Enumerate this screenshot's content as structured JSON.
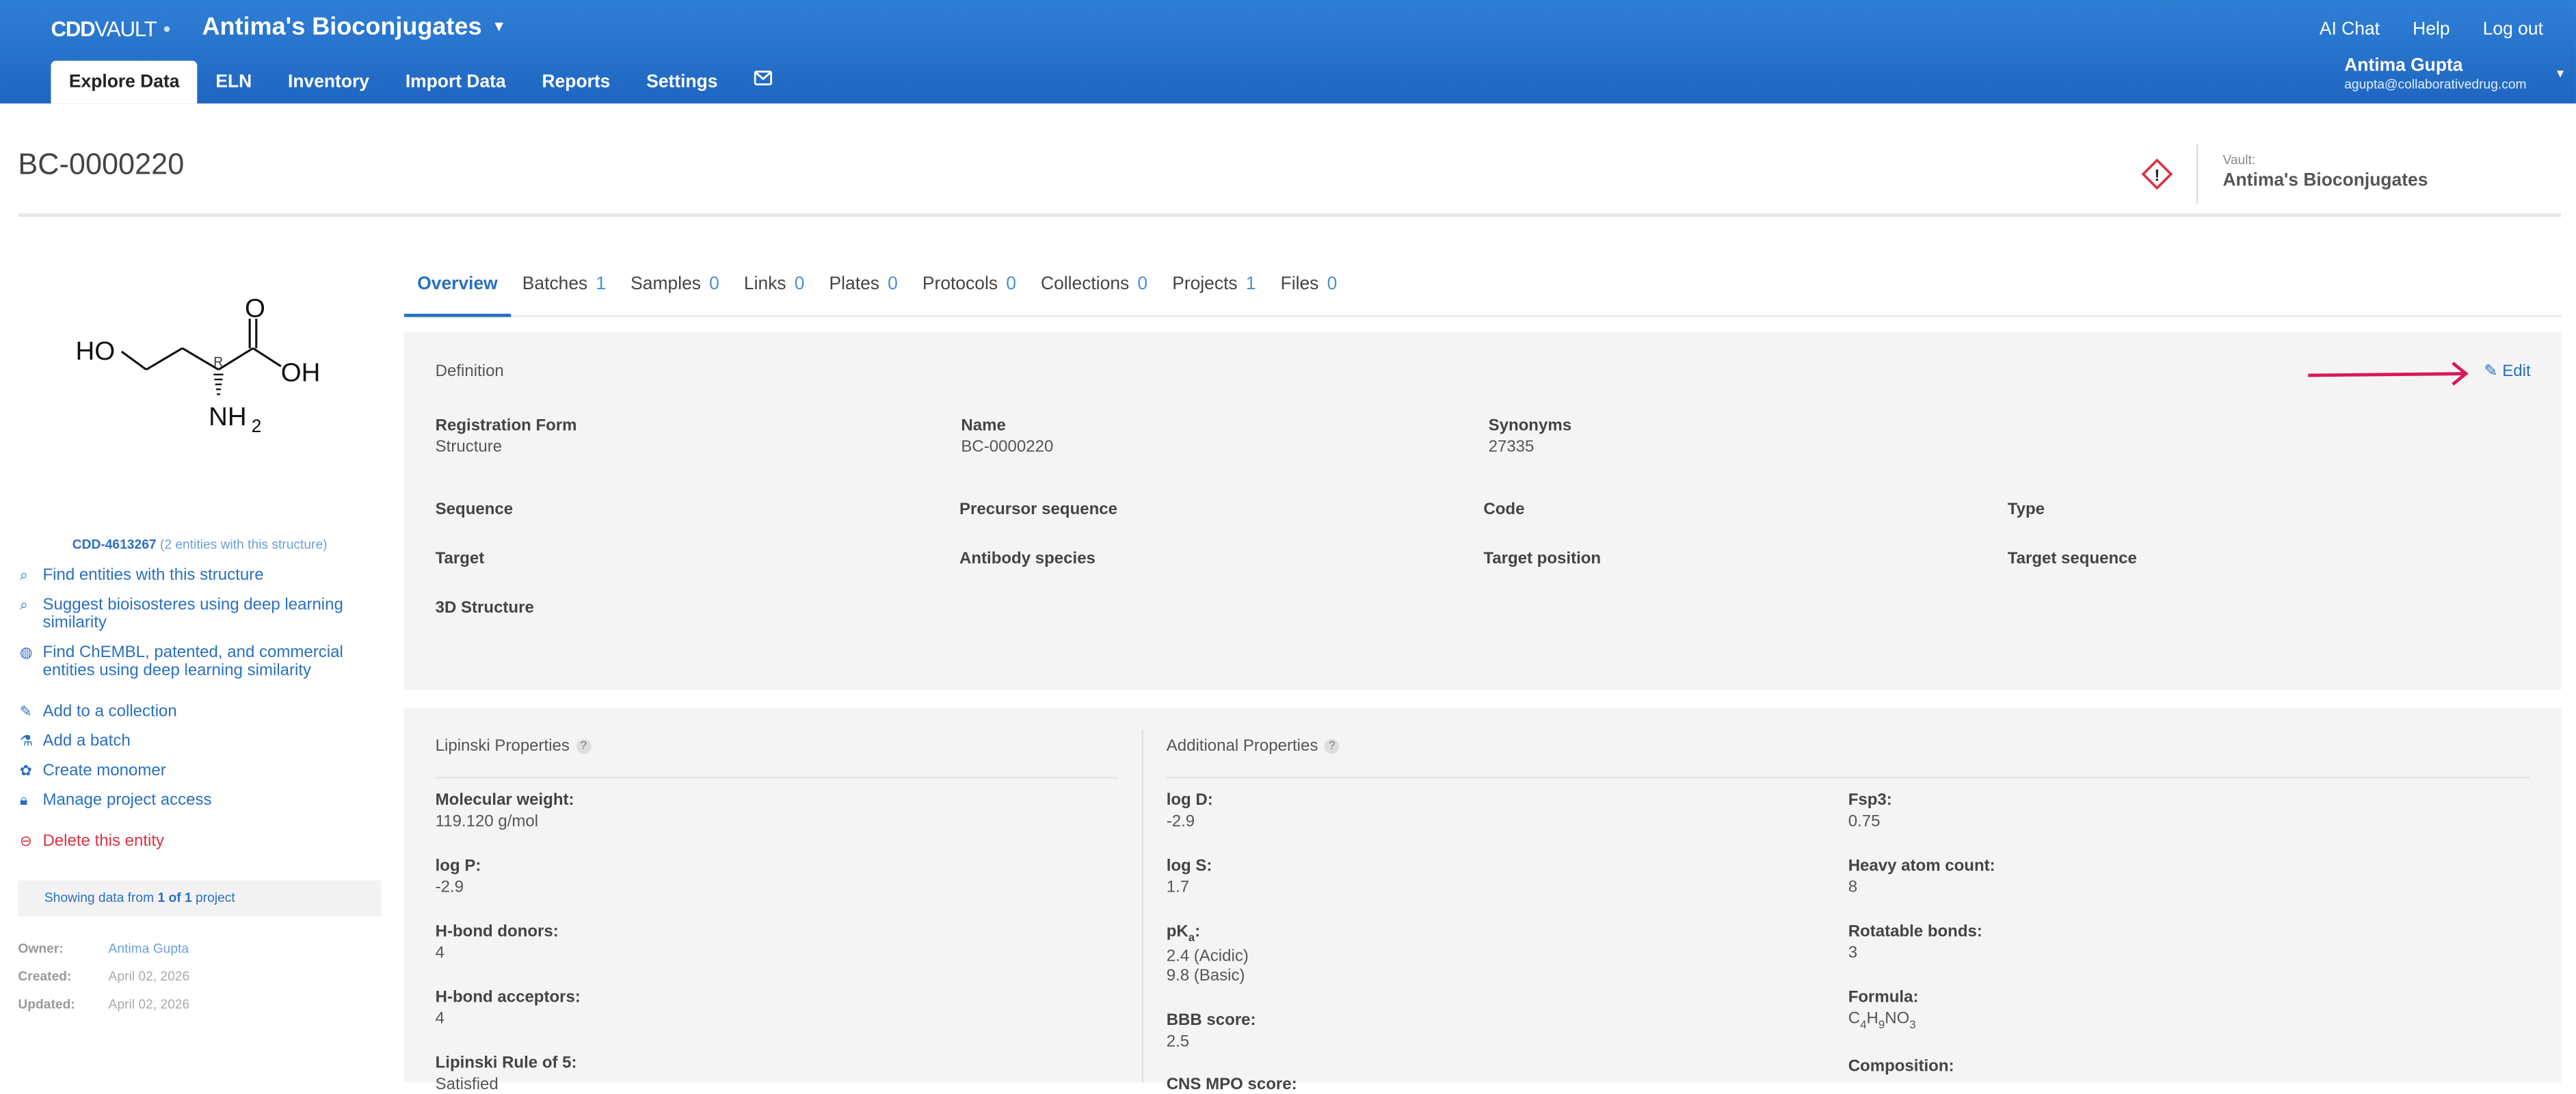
{
  "header": {
    "logo_bold": "CDD",
    "logo_light": "VAULT",
    "vault_name": "Antima's Bioconjugates",
    "right_links": [
      "AI Chat",
      "Help",
      "Log out"
    ],
    "nav": [
      "Explore Data",
      "ELN",
      "Inventory",
      "Import Data",
      "Reports",
      "Settings"
    ],
    "user_name": "Antima Gupta",
    "user_email": "agupta@collaborativedrug.com"
  },
  "entity": {
    "title": "BC-0000220",
    "vault_label": "Vault:",
    "vault_value": "Antima's Bioconjugates"
  },
  "structure": {
    "atoms": [
      "HO",
      "O",
      "OH",
      "NH",
      "2",
      "R"
    ],
    "cdd_id": "CDD-4613267",
    "cdd_note": "(2 entities with this structure)"
  },
  "left_actions": [
    {
      "icon": "search-icon",
      "label": "Find entities with this structure"
    },
    {
      "icon": "search-icon",
      "label": "Suggest bioisosteres using deep learning similarity"
    },
    {
      "icon": "globe-icon",
      "label": "Find ChEMBL, patented, and commercial entities using deep learning similarity"
    },
    {
      "icon": "collection-icon",
      "label": "Add to a collection"
    },
    {
      "icon": "flask-icon",
      "label": "Add a batch"
    },
    {
      "icon": "monomer-icon",
      "label": "Create monomer"
    },
    {
      "icon": "lock-icon",
      "label": "Manage project access"
    },
    {
      "icon": "delete-icon",
      "label": "Delete this entity"
    }
  ],
  "project_box": {
    "prefix": "Showing data from ",
    "count": "1 of 1",
    "suffix": " project"
  },
  "meta": [
    {
      "key": "Owner:",
      "value": "Antima Gupta"
    },
    {
      "key": "Created:",
      "value": "April 02, 2026"
    },
    {
      "key": "Updated:",
      "value": "April 02, 2026"
    }
  ],
  "tabs": [
    {
      "label": "Overview",
      "count": ""
    },
    {
      "label": "Batches",
      "count": "1"
    },
    {
      "label": "Samples",
      "count": "0"
    },
    {
      "label": "Links",
      "count": "0"
    },
    {
      "label": "Plates",
      "count": "0"
    },
    {
      "label": "Protocols",
      "count": "0"
    },
    {
      "label": "Collections",
      "count": "0"
    },
    {
      "label": "Projects",
      "count": "1"
    },
    {
      "label": "Files",
      "count": "0"
    }
  ],
  "definition": {
    "title": "Definition",
    "edit": "Edit",
    "fields": [
      {
        "label": "Registration Form",
        "value": "Structure"
      },
      {
        "label": "Name",
        "value": "BC-0000220"
      },
      {
        "label": "Synonyms",
        "value": "27335"
      },
      {
        "label": "Sequence",
        "value": ""
      },
      {
        "label": "Precursor sequence",
        "value": ""
      },
      {
        "label": "Code",
        "value": ""
      },
      {
        "label": "Type",
        "value": ""
      },
      {
        "label": "Target",
        "value": ""
      },
      {
        "label": "Antibody species",
        "value": ""
      },
      {
        "label": "Target position",
        "value": ""
      },
      {
        "label": "Target sequence",
        "value": ""
      },
      {
        "label": "3D Structure",
        "value": ""
      }
    ]
  },
  "lipinski": {
    "title": "Lipinski Properties",
    "help": "?",
    "items": [
      {
        "label": "Molecular weight:",
        "value": "119.120 g/mol"
      },
      {
        "label": "log P:",
        "value": "-2.9"
      },
      {
        "label": "H-bond donors:",
        "value": "4"
      },
      {
        "label": "H-bond acceptors:",
        "value": "4"
      },
      {
        "label": "Lipinski Rule of 5:",
        "value": "Satisfied"
      }
    ]
  },
  "additional": {
    "title": "Additional Properties",
    "help": "?",
    "col1": [
      {
        "label": "log D:",
        "value": "-2.9"
      },
      {
        "label": "log S:",
        "value": "1.7"
      },
      {
        "label": "pK",
        "label_sub": "a",
        "label_suffix": ":",
        "value": "2.4 (Acidic)",
        "value2": "9.8 (Basic)"
      },
      {
        "label": "BBB score:",
        "value": "2.5"
      },
      {
        "label": "CNS MPO score:",
        "value": ""
      }
    ],
    "col2": [
      {
        "label": "Fsp3:",
        "value": "0.75"
      },
      {
        "label": "Heavy atom count:",
        "value": "8"
      },
      {
        "label": "Rotatable bonds:",
        "value": "3"
      },
      {
        "label": "Formula:",
        "formula": [
          "C",
          "4",
          "H",
          "9",
          "NO",
          "3"
        ]
      },
      {
        "label": "Composition:",
        "value": ""
      }
    ]
  }
}
